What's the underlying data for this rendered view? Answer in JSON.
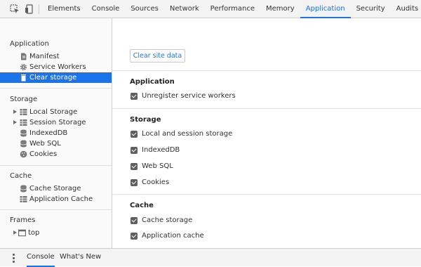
{
  "toolbar": {
    "tabs": [
      "Elements",
      "Console",
      "Sources",
      "Network",
      "Performance",
      "Memory",
      "Application",
      "Security",
      "Audits"
    ],
    "active_tab": "Application"
  },
  "sidebar": {
    "application": {
      "title": "Application",
      "items": [
        {
          "label": "Manifest",
          "icon": "manifest-icon"
        },
        {
          "label": "Service Workers",
          "icon": "gear-icon"
        },
        {
          "label": "Clear storage",
          "icon": "trash-icon",
          "selected": true
        }
      ]
    },
    "storage": {
      "title": "Storage",
      "items": [
        {
          "label": "Local Storage",
          "icon": "grid-icon",
          "expandable": true
        },
        {
          "label": "Session Storage",
          "icon": "grid-icon",
          "expandable": true
        },
        {
          "label": "IndexedDB",
          "icon": "database-icon"
        },
        {
          "label": "Web SQL",
          "icon": "database-icon"
        },
        {
          "label": "Cookies",
          "icon": "cookie-icon"
        }
      ]
    },
    "cache": {
      "title": "Cache",
      "items": [
        {
          "label": "Cache Storage",
          "icon": "database-icon"
        },
        {
          "label": "Application Cache",
          "icon": "grid-icon"
        }
      ]
    },
    "frames": {
      "title": "Frames",
      "items": [
        {
          "label": "top",
          "icon": "frame-icon",
          "expandable": true
        }
      ]
    }
  },
  "main": {
    "clear_button": "Clear site data",
    "application": {
      "title": "Application",
      "options": [
        {
          "label": "Unregister service workers",
          "checked": true
        }
      ]
    },
    "storage": {
      "title": "Storage",
      "options": [
        {
          "label": "Local and session storage",
          "checked": true
        },
        {
          "label": "IndexedDB",
          "checked": true
        },
        {
          "label": "Web SQL",
          "checked": true
        },
        {
          "label": "Cookies",
          "checked": true
        }
      ]
    },
    "cache": {
      "title": "Cache",
      "options": [
        {
          "label": "Cache storage",
          "checked": true
        },
        {
          "label": "Application cache",
          "checked": true
        }
      ]
    }
  },
  "drawer": {
    "tabs": [
      "Console",
      "What's New"
    ],
    "active_tab": "Console"
  },
  "colors": {
    "accent": "#1a73e8",
    "toolbar_bg": "#f3f3f3",
    "sidebar_bg": "#fafafa"
  }
}
